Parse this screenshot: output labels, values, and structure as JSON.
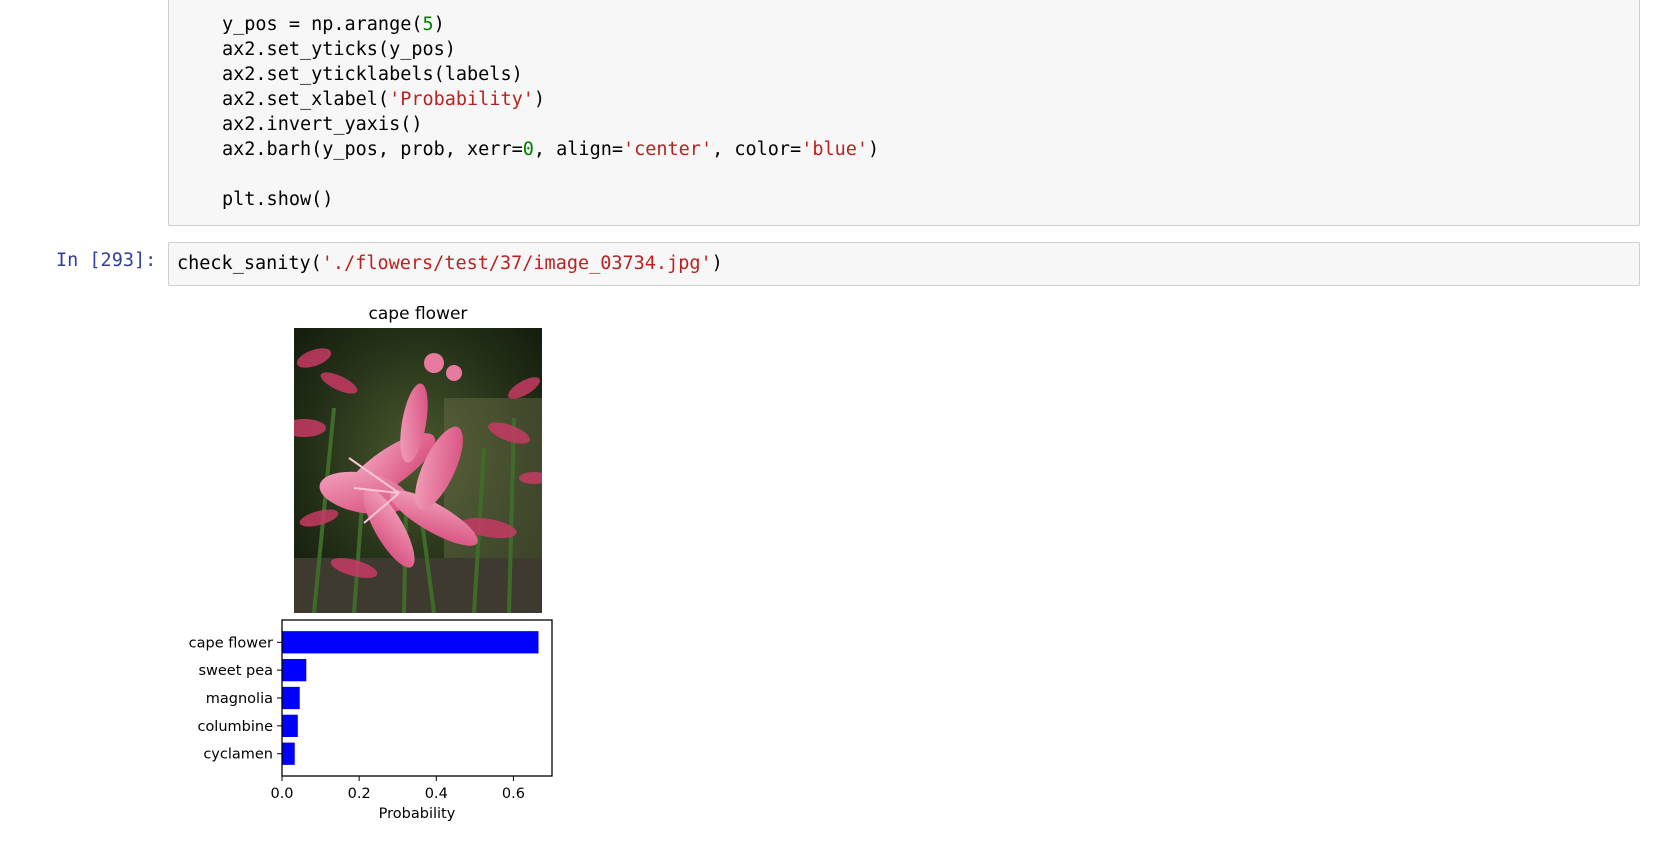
{
  "prev_cell": {
    "code_lines": [
      [
        {
          "t": "y_pos = np.arange(",
          "c": ""
        },
        {
          "t": "5",
          "c": "num"
        },
        {
          "t": ")",
          "c": ""
        }
      ],
      [
        {
          "t": "ax2.set_yticks(y_pos)",
          "c": ""
        }
      ],
      [
        {
          "t": "ax2.set_yticklabels(labels)",
          "c": ""
        }
      ],
      [
        {
          "t": "ax2.set_xlabel(",
          "c": ""
        },
        {
          "t": "'Probability'",
          "c": "str"
        },
        {
          "t": ")",
          "c": ""
        }
      ],
      [
        {
          "t": "ax2.invert_yaxis()",
          "c": ""
        }
      ],
      [
        {
          "t": "ax2.barh(y_pos, prob, xerr=",
          "c": ""
        },
        {
          "t": "0",
          "c": "num"
        },
        {
          "t": ", align=",
          "c": ""
        },
        {
          "t": "'center'",
          "c": "str"
        },
        {
          "t": ", color=",
          "c": ""
        },
        {
          "t": "'blue'",
          "c": "str"
        },
        {
          "t": ")",
          "c": ""
        }
      ],
      [
        {
          "t": "",
          "c": ""
        }
      ],
      [
        {
          "t": "plt.show()",
          "c": ""
        }
      ]
    ]
  },
  "current_cell": {
    "prompt": "In [293]:",
    "code_lines": [
      [
        {
          "t": "check_sanity(",
          "c": ""
        },
        {
          "t": "'./flowers/test/37/image_03734.jpg'",
          "c": "str"
        },
        {
          "t": ")",
          "c": ""
        }
      ]
    ]
  },
  "output": {
    "image_title": "cape flower",
    "chart_data": {
      "type": "bar",
      "orientation": "horizontal",
      "categories": [
        "cape flower",
        "sweet pea",
        "magnolia",
        "columbine",
        "cyclamen"
      ],
      "values": [
        0.665,
        0.063,
        0.046,
        0.041,
        0.033
      ],
      "xlabel": "Probability",
      "ylabel": "",
      "xlim": [
        0,
        0.7
      ],
      "xticks": [
        "0.0",
        "0.2",
        "0.4",
        "0.6"
      ],
      "bar_color": "#0000ff",
      "grid": false
    }
  }
}
